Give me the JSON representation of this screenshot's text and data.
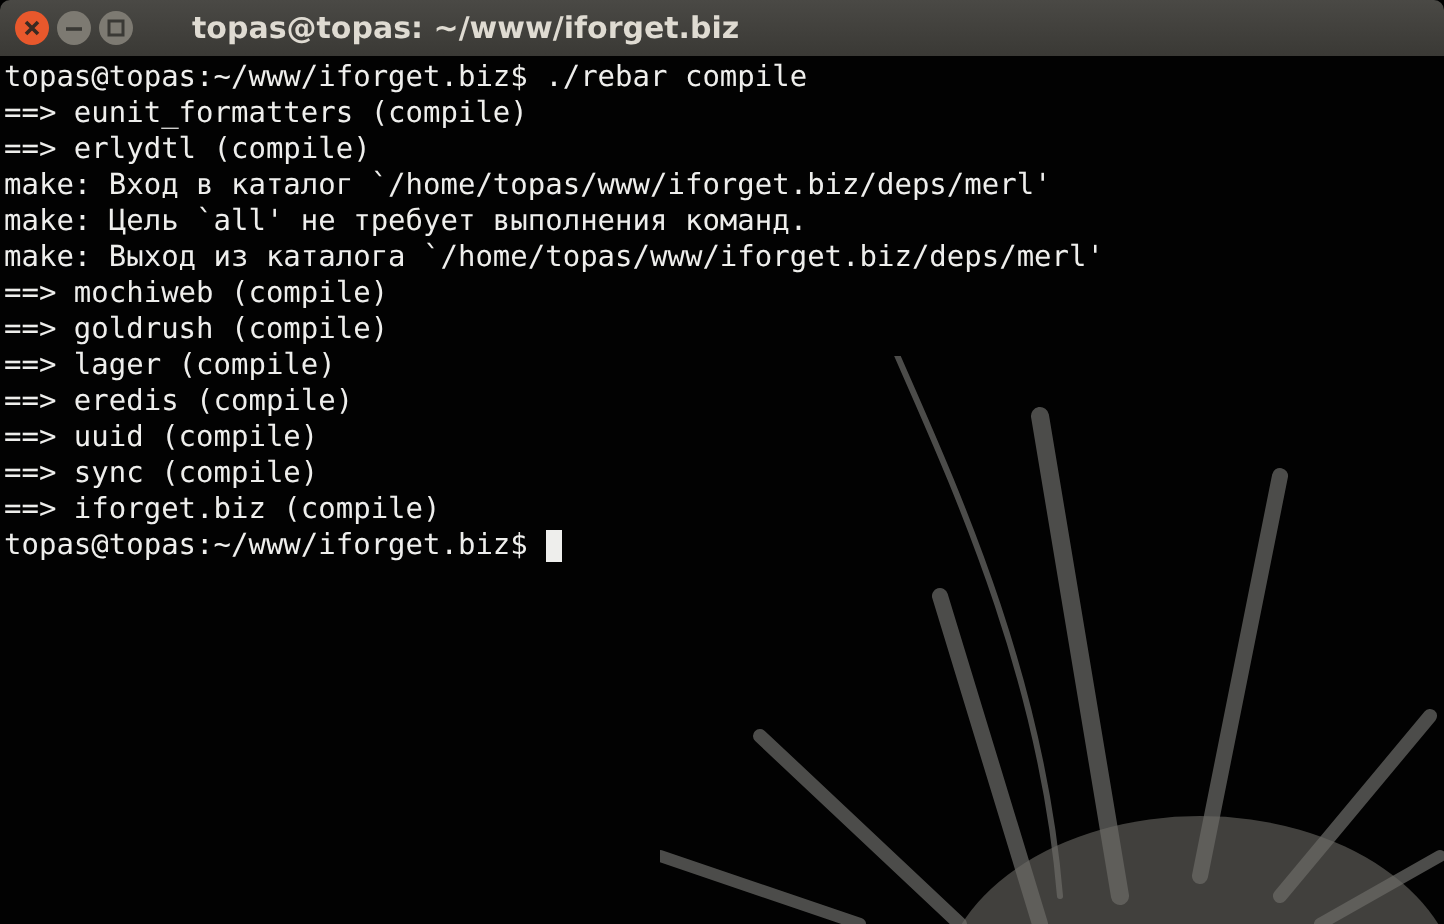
{
  "window": {
    "title": "topas@topas: ~/www/iforget.biz"
  },
  "terminal": {
    "lines": [
      "topas@topas:~/www/iforget.biz$ ./rebar compile",
      "==> eunit_formatters (compile)",
      "==> erlydtl (compile)",
      "make: Вход в каталог `/home/topas/www/iforget.biz/deps/merl'",
      "make: Цель `all' не требует выполнения команд.",
      "make: Выход из каталога `/home/topas/www/iforget.biz/deps/merl'",
      "==> mochiweb (compile)",
      "==> goldrush (compile)",
      "==> lager (compile)",
      "==> eredis (compile)",
      "==> uuid (compile)",
      "==> sync (compile)",
      "==> iforget.biz (compile)"
    ],
    "prompt": "topas@topas:~/www/iforget.biz$"
  }
}
